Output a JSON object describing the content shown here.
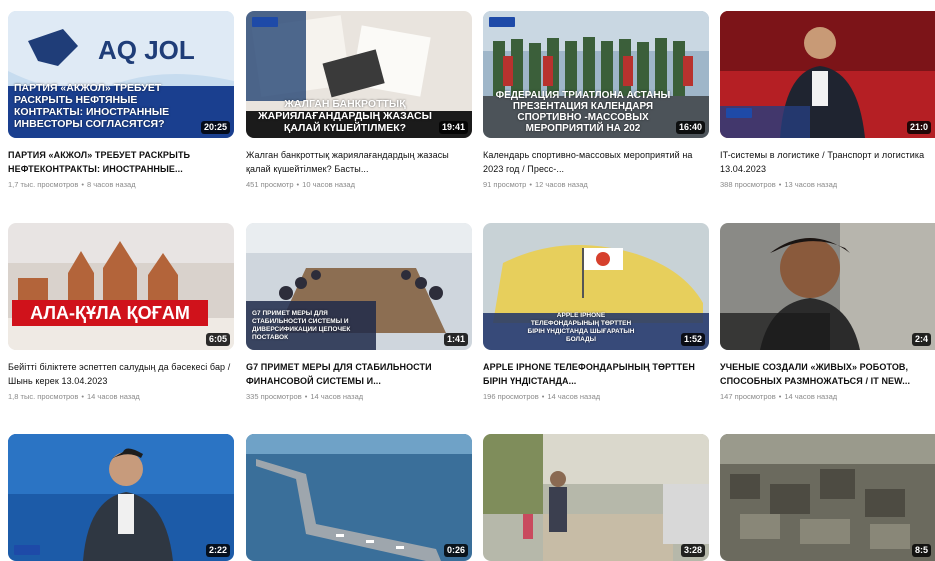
{
  "videos": [
    {
      "thumb_caption": "ПАРТИЯ «АКЖОЛ» ТРЕБУЕТ РАСКРЫТЬ НЕФТЯНЫЕ КОНТРАКТЫ: ИНОСТРАННЫЕ ИНВЕСТОРЫ СОГЛАСЯТСЯ?",
      "duration": "20:25",
      "title": "ПАРТИЯ «АКЖОЛ» ТРЕБУЕТ РАСКРЫТЬ НЕФТЕКОНТРАКТЫ: ИНОСТРАННЫЕ...",
      "views": "1,7 тыс. просмотров",
      "age": "8 часов назад"
    },
    {
      "thumb_caption": "ЖАЛГАН БАНКРОТТЫҚ ЖАРИЯЛАҒАНДАРДЫҢ ЖАЗАСЫ ҚАЛАЙ КҮШЕЙТІЛМЕК?",
      "duration": "19:41",
      "title": "Жалган банкроттық жариялағандардың жазасы қалай күшейтілмек? Басты...",
      "views": "451 просмотр",
      "age": "10 часов назад"
    },
    {
      "thumb_caption": "ФЕДЕРАЦИЯ ТРИАТЛОНА АСТАНЫ ПРЕЗЕНТАЦИЯ КАЛЕНДАРЯ СПОРТИВНО -МАССОВЫХ МЕРОПРИЯТИЙ НА 202",
      "duration": "16:40",
      "title": "Календарь спортивно-массовых мероприятий на 2023 год / Пресс-...",
      "views": "91 просмотр",
      "age": "12 часов назад"
    },
    {
      "thumb_caption": "",
      "duration": "21:0",
      "title": "IT-системы в логистике / Транспорт и логистика 13.04.2023",
      "views": "388 просмотров",
      "age": "13 часов назад"
    },
    {
      "thumb_caption": "АЛА-ҚҰЛА ҚОҒАМ",
      "duration": "6:05",
      "title": "Бейітті біліктете эспеттеп салудың да бәсекесі бар / Шынь керек 13.04.2023",
      "views": "1,8 тыс. просмотров",
      "age": "14 часов назад"
    },
    {
      "thumb_caption": "G7 ПРИМЕТ МЕРЫ ДЛЯ СТАБИЛЬНОСТИ СИСТЕМЫ И ДИВЕРСИФИКАЦИИ ЦЕПОЧЕК ПОСТАВОК",
      "duration": "1:41",
      "title": "G7 ПРИМЕТ МЕРЫ ДЛЯ СТАБИЛЬНОСТИ ФИНАНСОВОЙ СИСТЕМЫ И...",
      "views": "335 просмотров",
      "age": "14 часов назад"
    },
    {
      "thumb_caption": "APPLE IPHONE ТЕЛЕФОНДАРЫНЫҢ ТӨРТТЕН БІРІН ҮНДІСТАНДА ШЫҒАРАТЫН БОЛАДЫ",
      "duration": "1:52",
      "title": "APPLE IPHONE ТЕЛЕФОНДАРЫНЫҢ ТӨРТТЕН БІРІН ҮНДІСТАНДА...",
      "views": "196 просмотров",
      "age": "14 часов назад"
    },
    {
      "thumb_caption": "",
      "duration": "2:4",
      "title": "УЧЕНЫЕ СОЗДАЛИ «ЖИВЫХ» РОБОТОВ, СПОСОБНЫХ РАЗМНОЖАТЬСЯ / IT NEW...",
      "views": "147 просмотров",
      "age": "14 часов назад"
    },
    {
      "duration": "2:22"
    },
    {
      "duration": "0:26"
    },
    {
      "duration": "3:28"
    },
    {
      "duration": "8:5"
    }
  ]
}
